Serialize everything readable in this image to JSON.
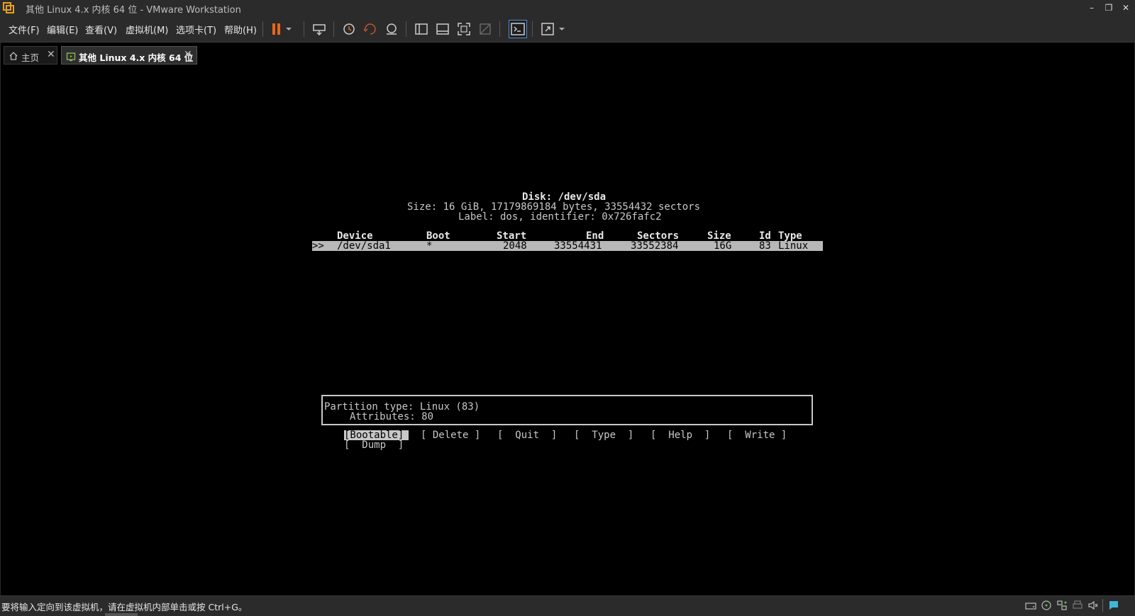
{
  "window": {
    "title": "其他 Linux 4.x 内核 64 位 - VMware Workstation",
    "minimize": "–",
    "restore": "❐",
    "close": "✕"
  },
  "menu": {
    "file": "文件(F)",
    "edit": "编辑(E)",
    "view": "查看(V)",
    "vm": "虚拟机(M)",
    "tabs": "选项卡(T)",
    "help": "帮助(H)"
  },
  "toolbar": {
    "icons": [
      "pause-icon",
      "send-ctrl-alt-del-icon",
      "snapshot-icon",
      "revert-snapshot-icon",
      "snapshot-manager-icon",
      "library-icon",
      "thumbnail-bar-icon",
      "fullscreen-icon",
      "unity-icon",
      "console-view-icon",
      "stretch-icon"
    ],
    "accent": "#e8661c"
  },
  "tabs": [
    {
      "label": "主页",
      "close": "✕"
    },
    {
      "label": "其他 Linux 4.x 内核 64 位",
      "close": "✕"
    }
  ],
  "console": {
    "disk_title": "Disk: /dev/sda",
    "size_line": "Size: 16 GiB, 17179869184 bytes, 33554432 sectors",
    "label_line": "Label: dos, identifier: 0x726fafc2",
    "headers": {
      "device": "Device",
      "boot": "Boot",
      "start": "Start",
      "end": "End",
      "sectors": "Sectors",
      "size": "Size",
      "id": "Id",
      "type": "Type"
    },
    "row": {
      "cursor": ">>",
      "device": "/dev/sda1",
      "boot": "*",
      "start": "2048",
      "end": "33554431",
      "sectors": "33552384",
      "size": "16G",
      "id": "83",
      "type": "Linux"
    },
    "info_line1": "Partition type: Linux (83)",
    "info_line2": "Attributes: 80",
    "buttons": {
      "bootable": "[Bootable]",
      "delete": "[ Delete ]",
      "quit": "[  Quit  ]",
      "type": "[  Type  ]",
      "help": "[  Help  ]",
      "write": "[  Write ]",
      "dump": "[  Dump  ]"
    }
  },
  "statusbar": {
    "message": "要将输入定向到该虚拟机，请在虚拟机内部单击或按 Ctrl+G。",
    "icons": [
      "hard-disk-icon",
      "cd-drive-icon",
      "network-icon",
      "printer-icon",
      "sound-icon",
      "message-icon"
    ]
  }
}
